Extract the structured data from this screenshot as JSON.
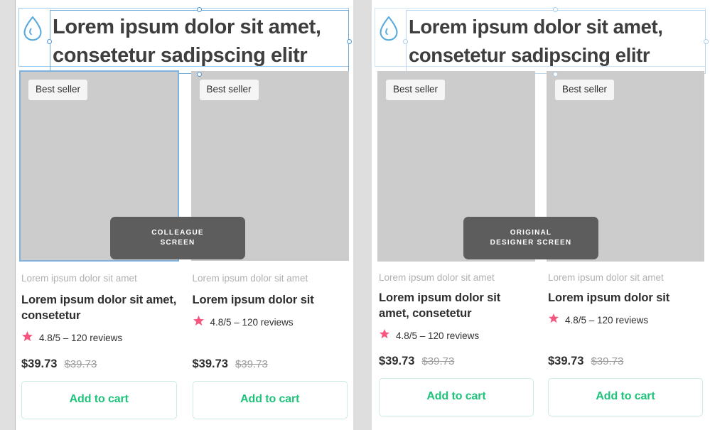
{
  "canvas": {
    "background": "#dedede",
    "panel_background": "#ffffff"
  },
  "colors": {
    "accent_green": "#1ec27a",
    "star_pink": "#f6567e",
    "selection_blue": "#6aa9d8",
    "selection_blue_faint": "#b9d7ef",
    "logo_blue": "#58a9dd",
    "image_placeholder": "#cccccc",
    "pill_gray": "#5d5d5d",
    "muted_text": "#b0b0b0",
    "body_text": "#2e2e2e"
  },
  "panels": [
    {
      "id": "colleague",
      "screen_label": "COLLEAGUE\nSCREEN",
      "selection_strength": "strong",
      "header": {
        "logo_icon": "water-droplet-icon",
        "title": "Lorem ipsum dolor sit amet,\nconsetetur sadipscing elitr",
        "selected": true
      },
      "cards": [
        {
          "badge": "Best seller",
          "image_selected": true,
          "eyebrow": "Lorem ipsum dolor sit amet",
          "name": "Lorem ipsum dolor sit amet, consetetur",
          "name_lines": 2,
          "star_icon": "star-icon",
          "rating": "4.8/5 – 120 reviews",
          "price": "$39.73",
          "price_old": "$39.73",
          "cta": "Add to cart"
        },
        {
          "badge": "Best seller",
          "image_selected": false,
          "eyebrow": "Lorem ipsum dolor sit amet",
          "name": "Lorem ipsum dolor sit",
          "name_lines": 1,
          "star_icon": "star-icon",
          "rating": "4.8/5 – 120 reviews",
          "price": "$39.73",
          "price_old": "$39.73",
          "cta": "Add to cart"
        }
      ]
    },
    {
      "id": "original",
      "screen_label": "ORIGINAL\nDESIGNER SCREEN",
      "selection_strength": "faint",
      "header": {
        "logo_icon": "water-droplet-icon",
        "title": "Lorem ipsum dolor sit amet,\nconsetetur sadipscing elitr",
        "selected": true
      },
      "cards": [
        {
          "badge": "Best seller",
          "image_selected": false,
          "eyebrow": "Lorem ipsum dolor sit amet",
          "name": "Lorem ipsum dolor sit amet, consetetur",
          "name_lines": 2,
          "star_icon": "star-icon",
          "rating": "4.8/5 – 120 reviews",
          "price": "$39.73",
          "price_old": "$39.73",
          "cta": "Add to cart"
        },
        {
          "badge": "Best seller",
          "image_selected": false,
          "eyebrow": "Lorem ipsum dolor sit amet",
          "name": "Lorem ipsum dolor sit",
          "name_lines": 1,
          "star_icon": "star-icon",
          "rating": "4.8/5 – 120 reviews",
          "price": "$39.73",
          "price_old": "$39.73",
          "cta": "Add to cart"
        }
      ]
    }
  ]
}
